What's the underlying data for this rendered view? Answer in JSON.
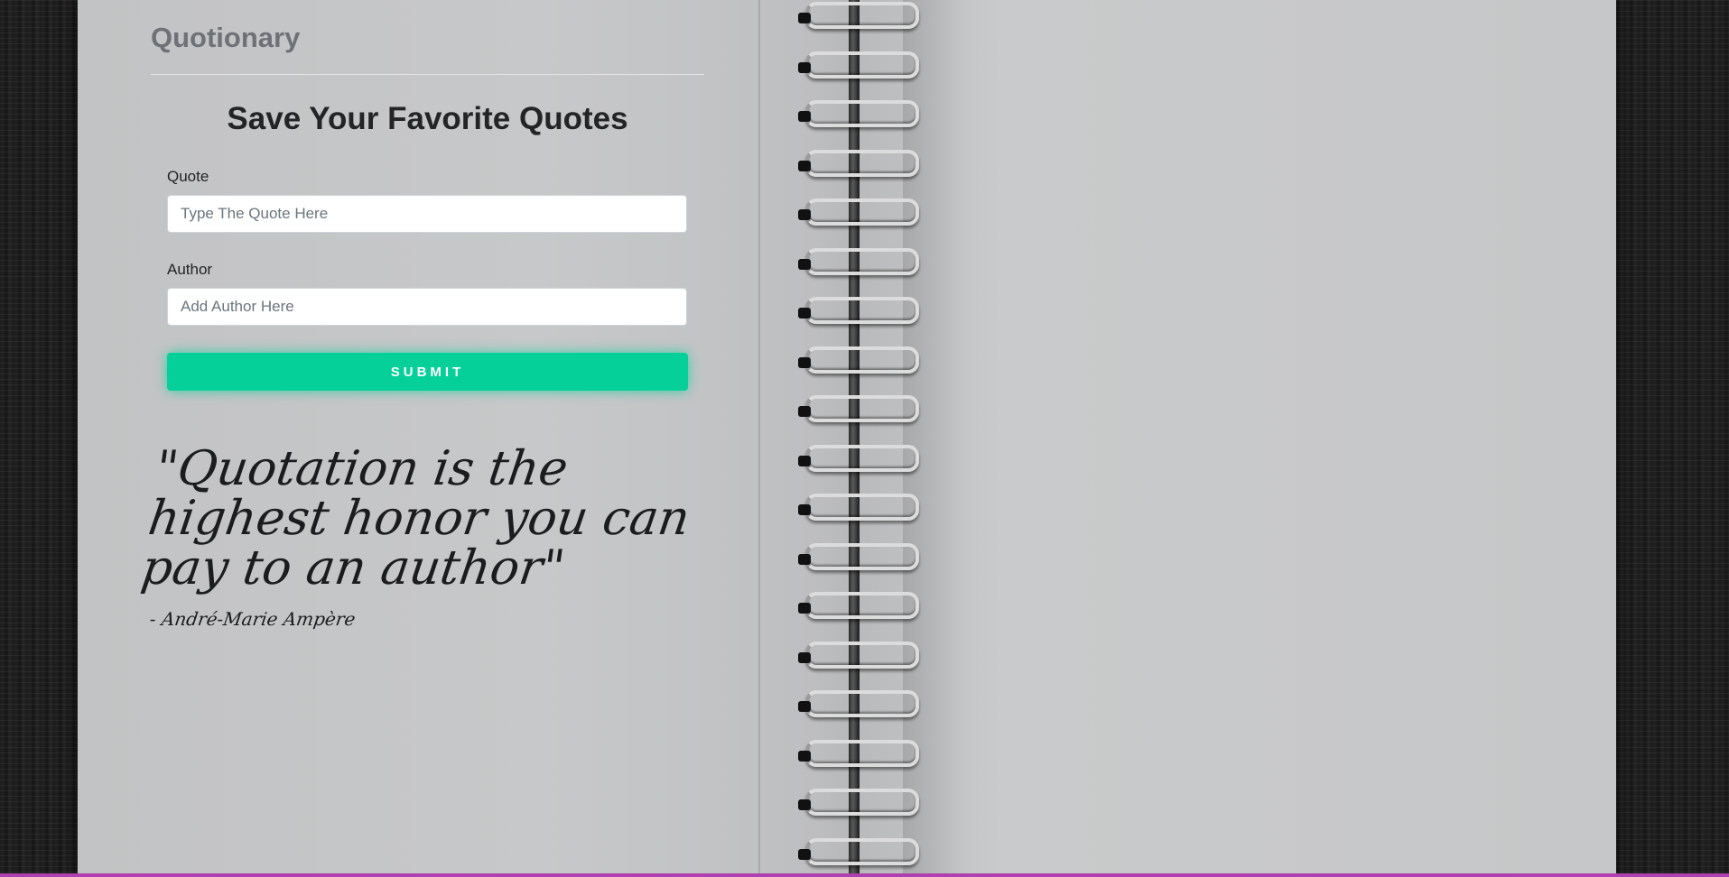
{
  "app": {
    "brand": "Quotionary"
  },
  "form": {
    "title": "Save Your Favorite Quotes",
    "quote_label": "Quote",
    "quote_placeholder": "Type The Quote Here",
    "quote_value": "",
    "author_label": "Author",
    "author_placeholder": "Add Author Here",
    "author_value": "",
    "submit_label": "SUBMIT"
  },
  "featured_quote": {
    "text": "\"Quotation is the highest honor you can pay to an author\"",
    "author": "- André-Marie Ampère"
  },
  "colors": {
    "accent": "#05d09a",
    "brand_text": "#6e7276",
    "heading": "#222426",
    "paper": "#c6c7c8",
    "background": "#1c1c1c"
  },
  "icons": {
    "background": "notebook-photo"
  }
}
